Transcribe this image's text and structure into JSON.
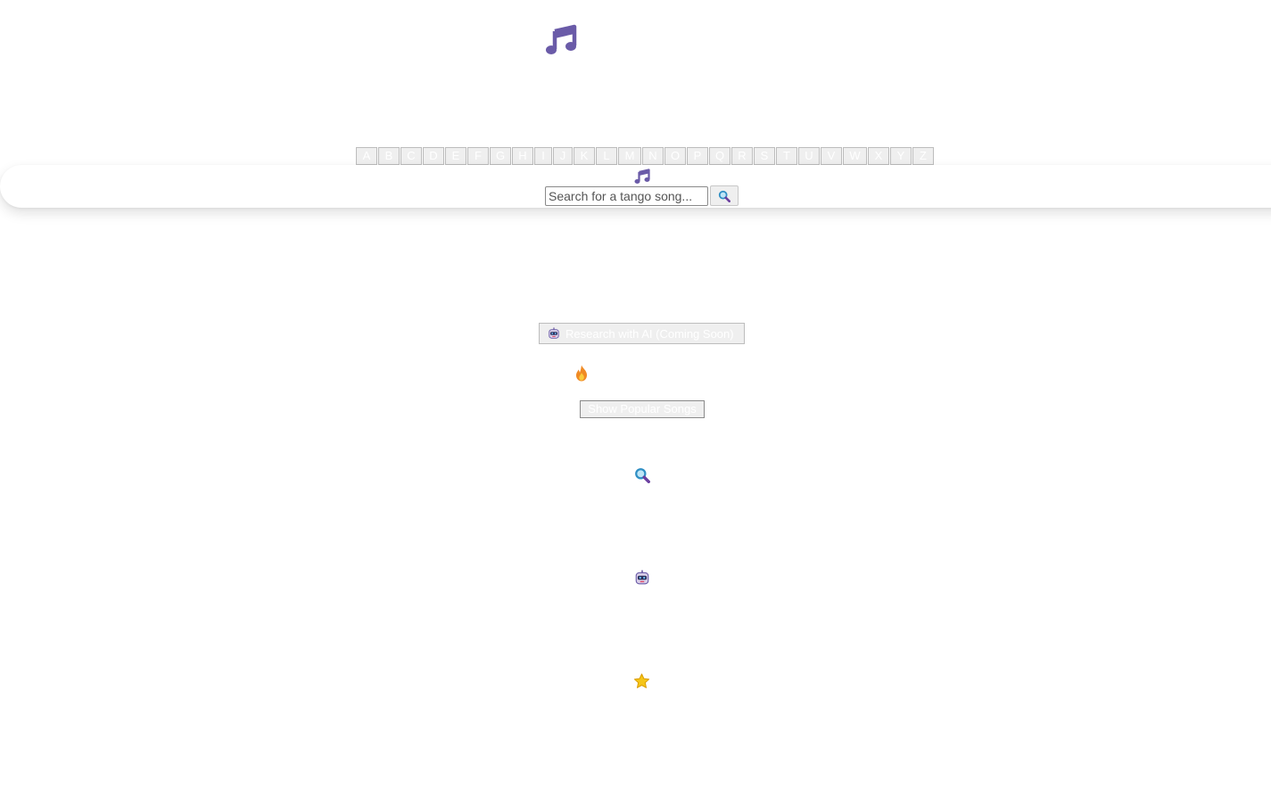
{
  "logo": {
    "icon": "music-note-icon",
    "color": "#6a5ba8"
  },
  "alphabet": [
    "A",
    "B",
    "C",
    "D",
    "E",
    "F",
    "G",
    "H",
    "I",
    "J",
    "K",
    "L",
    "M",
    "N",
    "O",
    "P",
    "Q",
    "R",
    "S",
    "T",
    "U",
    "V",
    "W",
    "X",
    "Y",
    "Z"
  ],
  "header": {
    "logo_icon": "music-note-icon",
    "search": {
      "placeholder": "Search for a tango song...",
      "value": "",
      "button_icon": "magnifier-icon"
    }
  },
  "research_ai": {
    "icon": "robot-icon",
    "label": "Research with AI (Coming Soon)"
  },
  "popular": {
    "icon": "fire-icon",
    "button_label": "Show Popular Songs"
  },
  "sections": [
    {
      "icon": "magnifier-icon"
    },
    {
      "icon": "robot-icon"
    },
    {
      "icon": "star-icon"
    }
  ],
  "colors": {
    "accent": "#6a5ba8",
    "button_bg": "#efefef"
  }
}
